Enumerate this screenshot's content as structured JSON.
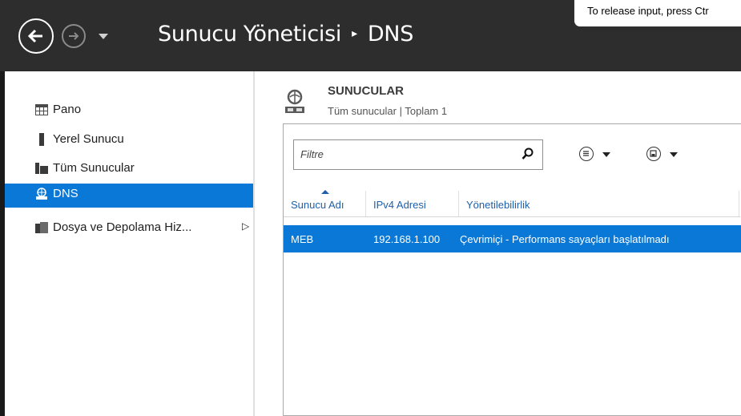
{
  "titlebar": {
    "app_title": "Sunucu Yöneticisi",
    "separator": "▸",
    "current": "DNS",
    "tooltip": "To release input, press Ctr"
  },
  "sidebar": {
    "items": [
      {
        "label": "Pano",
        "icon": "dashboard-icon"
      },
      {
        "label": "Yerel Sunucu",
        "icon": "server-icon"
      },
      {
        "label": "Tüm Sunucular",
        "icon": "servers-icon"
      },
      {
        "label": "DNS",
        "icon": "dns-icon",
        "selected": true
      },
      {
        "label": "Dosya ve Depolama Hiz...",
        "icon": "file-storage-icon",
        "expand": "▷"
      }
    ]
  },
  "main": {
    "tile_title": "SUNUCULAR",
    "tile_subtitle": "Tüm sunucular | Toplam 1",
    "filter_placeholder": "Filtre",
    "columns": [
      "Sunucu Adı",
      "IPv4 Adresi",
      "Yönetilebilirlik"
    ],
    "rows": [
      {
        "name": "MEB",
        "ipv4": "192.168.1.100",
        "status": "Çevrimiçi - Performans sayaçları başlatılmadı"
      }
    ]
  },
  "colors": {
    "titlebar_bg": "#2d2d2d",
    "selection": "#0a78d7",
    "header_link": "#1f5fa8"
  }
}
